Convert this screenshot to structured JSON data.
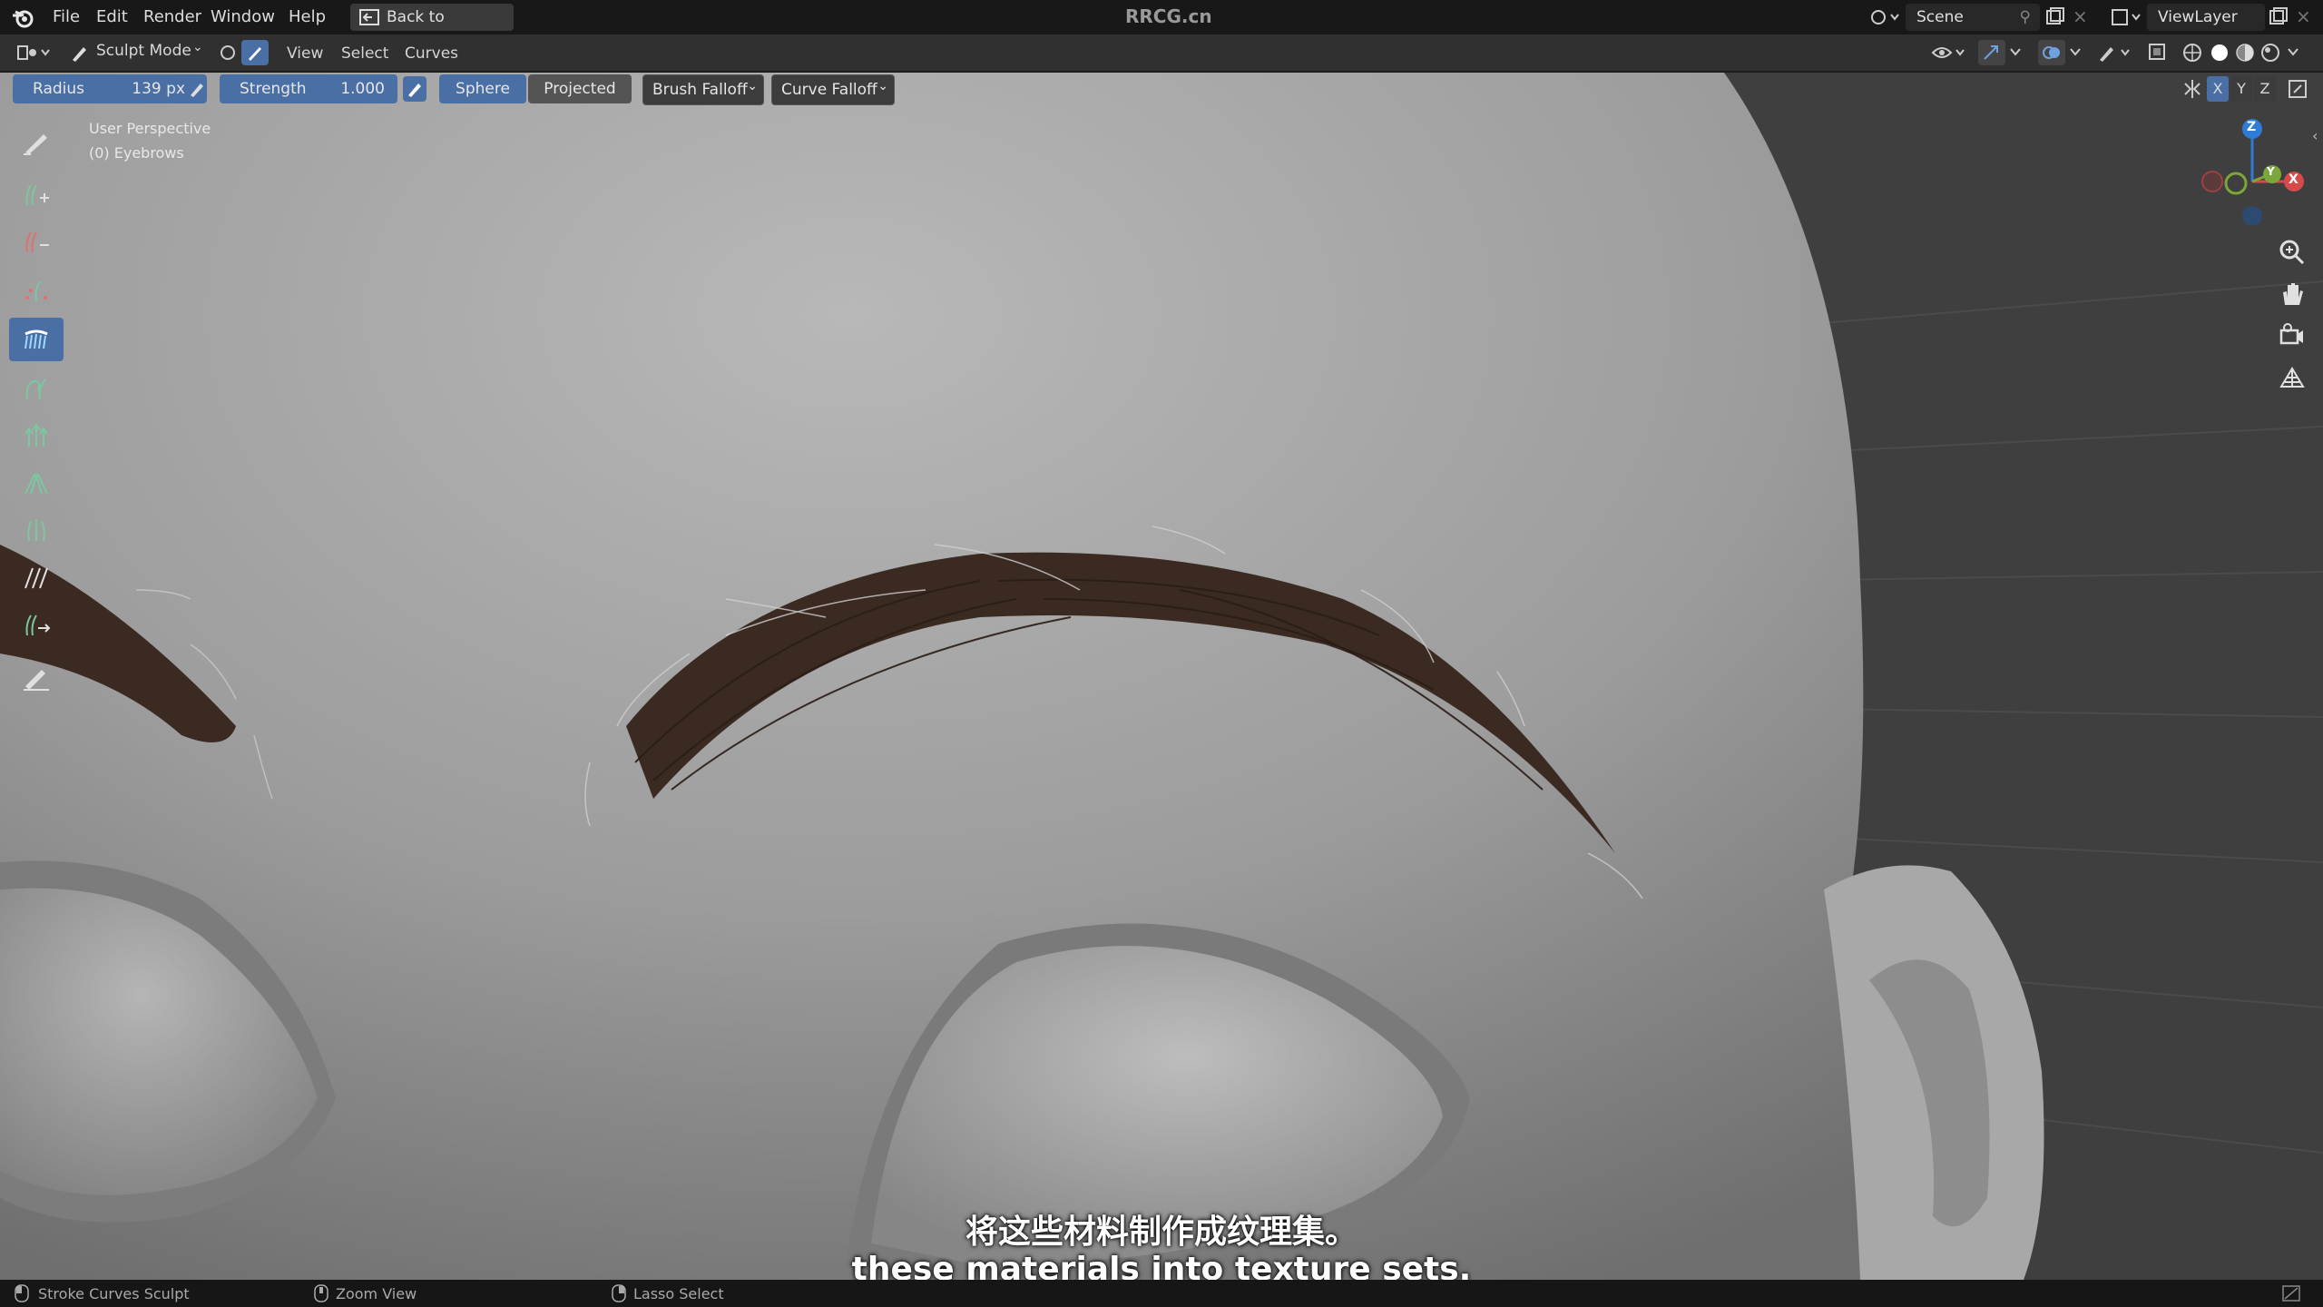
{
  "topbar": {
    "menus": [
      "File",
      "Edit",
      "Render",
      "Window",
      "Help"
    ],
    "back_label": "Back to Previous",
    "app_title": "RRCG.cn",
    "scene_label": "Scene",
    "viewlayer_label": "ViewLayer"
  },
  "header": {
    "mode_label": "Sculpt Mode",
    "menus": [
      "View",
      "Select",
      "Curves"
    ]
  },
  "tool_settings": {
    "radius_label": "Radius",
    "radius_value": "139 px",
    "strength_label": "Strength",
    "strength_value": "1.000",
    "sphere_label": "Sphere",
    "projected_label": "Projected",
    "brush_falloff_label": "Brush Falloff",
    "curve_falloff_label": "Curve Falloff",
    "axis_labels": [
      "X",
      "Y",
      "Z"
    ]
  },
  "viewport": {
    "view_name": "User Perspective",
    "object_name": "(0) Eyebrows",
    "gizmo_axes": {
      "z": "Z",
      "y": "Y",
      "x": "X"
    }
  },
  "subtitles": {
    "chinese": "将这些材料制作成纹理集。",
    "english": "these materials into texture sets."
  },
  "statusbar": {
    "item1": "Stroke Curves Sculpt",
    "item2": "Zoom View",
    "item3": "Lasso Select"
  },
  "colors": {
    "accent_blue": "#4a6fa5",
    "hair_dark": "#3a2a22",
    "skin_gray": "#8a8a8a"
  }
}
